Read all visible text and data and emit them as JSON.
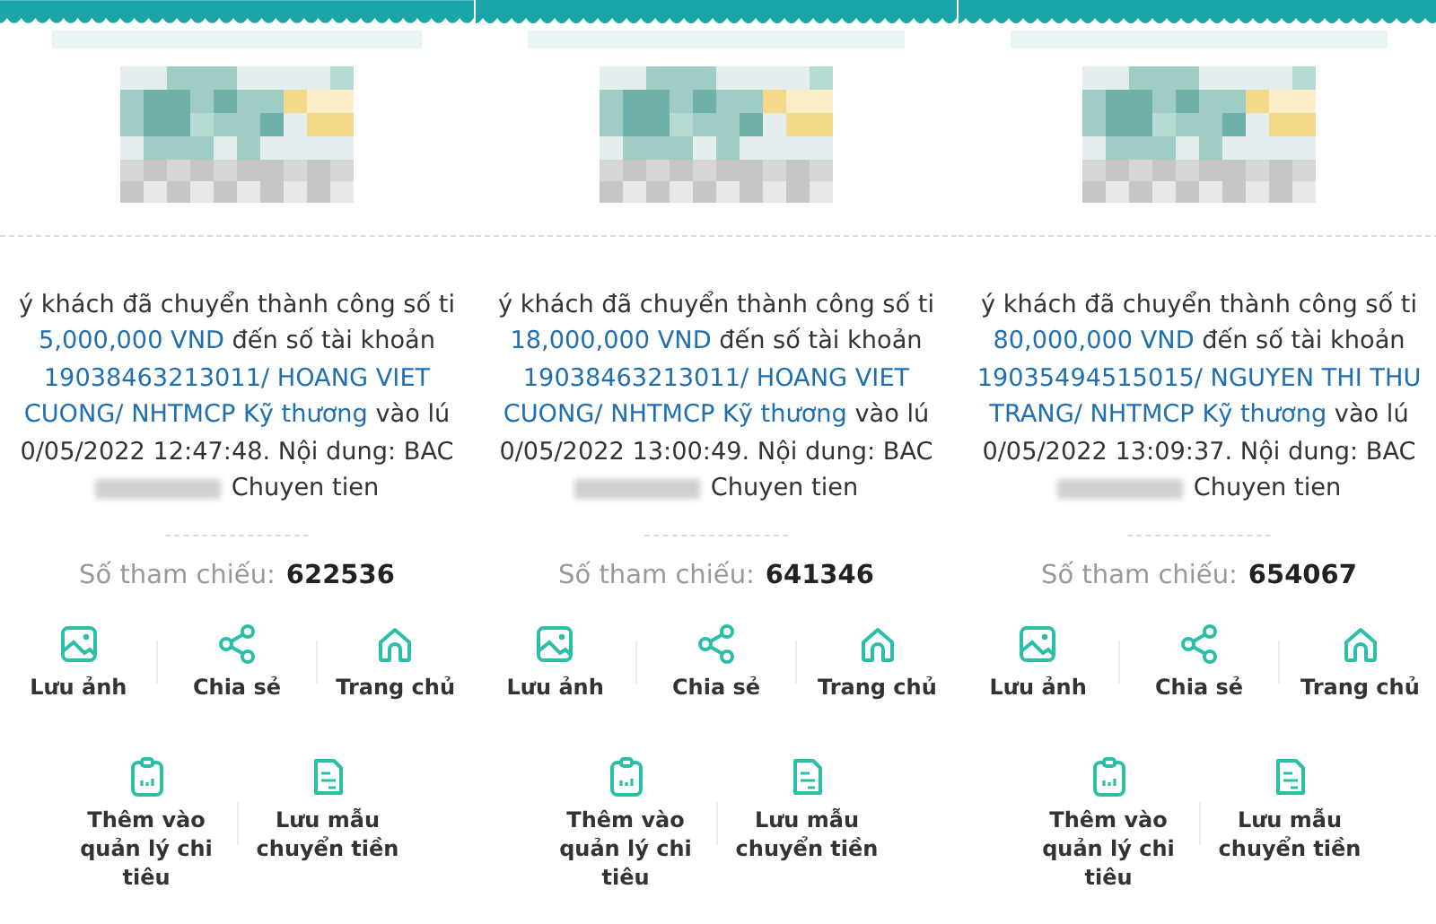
{
  "panels": [
    {
      "message_lines": [
        [
          {
            "kind": "plain",
            "text": "ý khách đã chuyển thành công số ti"
          }
        ],
        [
          {
            "kind": "highlight",
            "text": "5,000,000 VND"
          },
          {
            "kind": "plain",
            "text": " đến số tài khoản"
          }
        ],
        [
          {
            "kind": "highlight",
            "text": "19038463213011/ HOANG VIET"
          }
        ],
        [
          {
            "kind": "highlight",
            "text": "CUONG/ NHTMCP Kỹ thương"
          },
          {
            "kind": "plain",
            "text": " vào lú"
          }
        ],
        [
          {
            "kind": "plain",
            "text": "0/05/2022 12:47:48. Nội dung: BAC"
          }
        ]
      ],
      "content_tail": "Chuyen tien",
      "reference_label": "Số tham chiếu:",
      "reference_number": "622536",
      "actions": [
        {
          "kind": "image",
          "label": "Lưu ảnh"
        },
        {
          "kind": "share",
          "label": "Chia sẻ"
        },
        {
          "kind": "home",
          "label": "Trang chủ"
        }
      ],
      "more_actions": [
        {
          "kind": "clipboard",
          "label": "Thêm vào quản lý chi tiêu"
        },
        {
          "kind": "document",
          "label": "Lưu mẫu chuyển tiền"
        }
      ]
    },
    {
      "message_lines": [
        [
          {
            "kind": "plain",
            "text": "ý khách đã chuyển thành công số ti"
          }
        ],
        [
          {
            "kind": "highlight",
            "text": "18,000,000 VND"
          },
          {
            "kind": "plain",
            "text": " đến số tài khoản"
          }
        ],
        [
          {
            "kind": "highlight",
            "text": "19038463213011/ HOANG VIET"
          }
        ],
        [
          {
            "kind": "highlight",
            "text": "CUONG/ NHTMCP Kỹ thương"
          },
          {
            "kind": "plain",
            "text": " vào lú"
          }
        ],
        [
          {
            "kind": "plain",
            "text": "0/05/2022 13:00:49. Nội dung: BAC"
          }
        ]
      ],
      "content_tail": "Chuyen tien",
      "reference_label": "Số tham chiếu:",
      "reference_number": "641346",
      "actions": [
        {
          "kind": "image",
          "label": "Lưu ảnh"
        },
        {
          "kind": "share",
          "label": "Chia sẻ"
        },
        {
          "kind": "home",
          "label": "Trang chủ"
        }
      ],
      "more_actions": [
        {
          "kind": "clipboard",
          "label": "Thêm vào quản lý chi tiêu"
        },
        {
          "kind": "document",
          "label": "Lưu mẫu chuyển tiền"
        }
      ]
    },
    {
      "message_lines": [
        [
          {
            "kind": "plain",
            "text": "ý khách đã chuyển thành công số ti"
          }
        ],
        [
          {
            "kind": "highlight",
            "text": "80,000,000 VND"
          },
          {
            "kind": "plain",
            "text": " đến số tài khoản"
          }
        ],
        [
          {
            "kind": "highlight",
            "text": "19035494515015/ NGUYEN THI THU"
          }
        ],
        [
          {
            "kind": "highlight",
            "text": "TRANG/ NHTMCP Kỹ thương"
          },
          {
            "kind": "plain",
            "text": " vào lú"
          }
        ],
        [
          {
            "kind": "plain",
            "text": "0/05/2022 13:09:37. Nội dung: BAC"
          }
        ]
      ],
      "content_tail": "Chuyen tien",
      "reference_label": "Số tham chiếu:",
      "reference_number": "654067",
      "actions": [
        {
          "kind": "image",
          "label": "Lưu ảnh"
        },
        {
          "kind": "share",
          "label": "Chia sẻ"
        },
        {
          "kind": "home",
          "label": "Trang chủ"
        }
      ],
      "more_actions": [
        {
          "kind": "clipboard",
          "label": "Thêm vào quản lý chi tiêu"
        },
        {
          "kind": "document",
          "label": "Lưu mẫu chuyển tiền"
        }
      ]
    }
  ]
}
